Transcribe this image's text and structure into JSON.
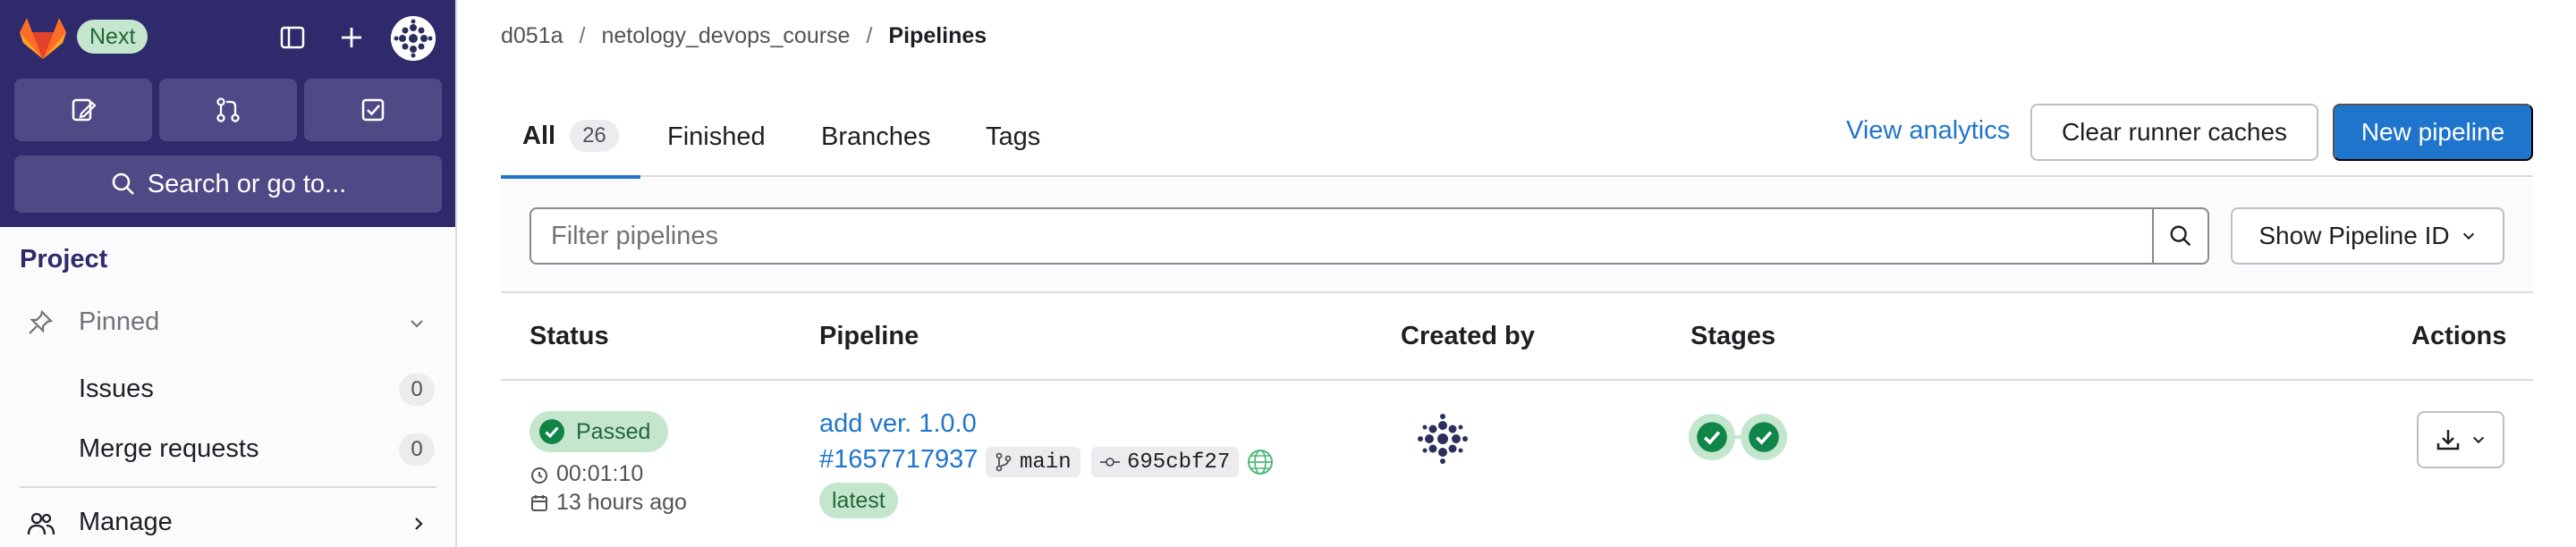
{
  "sidebar": {
    "next_badge": "Next",
    "search_label": "Search or go to...",
    "section_title": "Project",
    "pinned_label": "Pinned",
    "items": [
      {
        "label": "Issues",
        "count": "0"
      },
      {
        "label": "Merge requests",
        "count": "0"
      }
    ],
    "manage_label": "Manage"
  },
  "breadcrumb": {
    "items": [
      "d051a",
      "netology_devops_course",
      "Pipelines"
    ],
    "separator": "/"
  },
  "tabs": [
    {
      "label": "All",
      "count": "26",
      "active": true
    },
    {
      "label": "Finished"
    },
    {
      "label": "Branches"
    },
    {
      "label": "Tags"
    }
  ],
  "actions": {
    "analytics_link": "View analytics",
    "clear_caches": "Clear runner caches",
    "new_pipeline": "New pipeline"
  },
  "filter": {
    "placeholder": "Filter pipelines",
    "show_id_label": "Show Pipeline ID"
  },
  "table": {
    "headers": [
      "Status",
      "Pipeline",
      "Created by",
      "Stages",
      "Actions"
    ],
    "rows": [
      {
        "status": "Passed",
        "duration": "00:01:10",
        "finished": "13 hours ago",
        "commit_title": "add ver. 1.0.0",
        "pipeline_id": "#1657717937",
        "branch": "main",
        "commit_sha": "695cbf27",
        "tag_label": "latest",
        "stages": [
          "passed",
          "passed"
        ]
      }
    ]
  },
  "colors": {
    "brand": "#2f2a6b",
    "primary": "#1f75cb",
    "success": "#108548",
    "success_bg": "#c3e6cd"
  }
}
